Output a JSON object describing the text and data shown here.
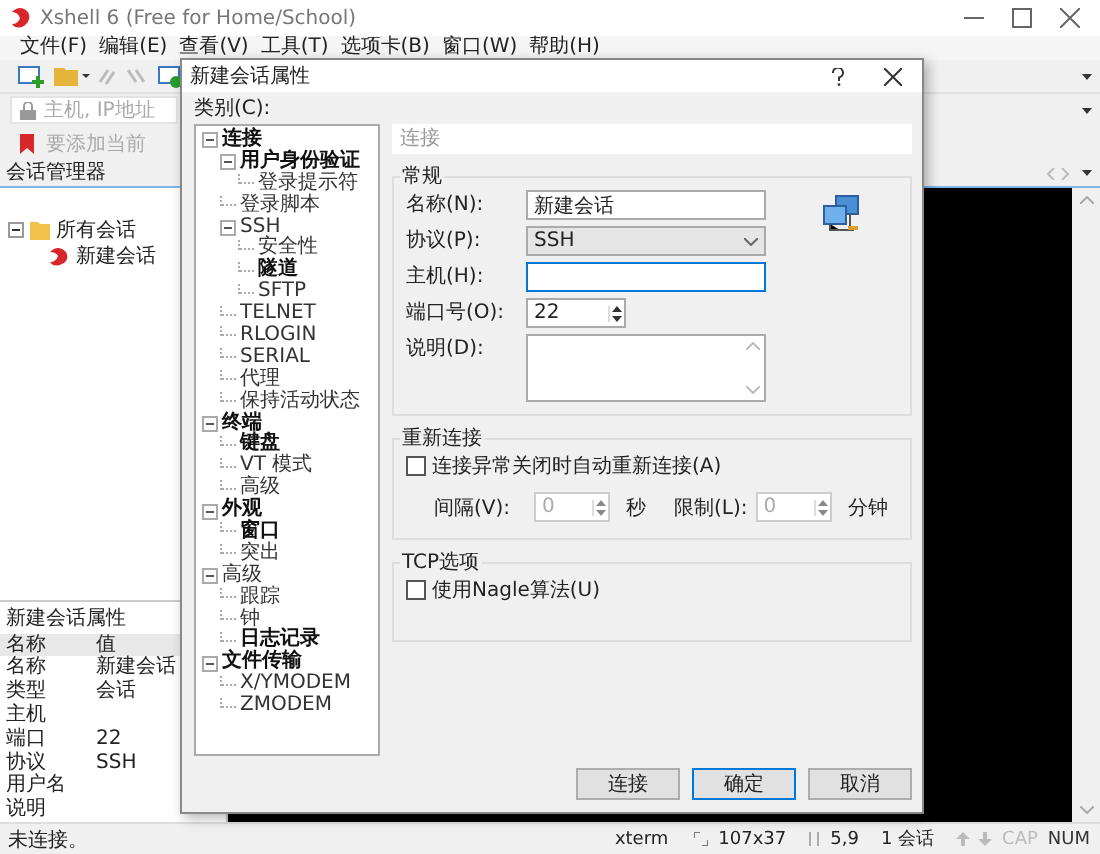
{
  "app": {
    "title": "Xshell 6 (Free for Home/School)",
    "menu": [
      "文件(F)",
      "编辑(E)",
      "查看(V)",
      "工具(T)",
      "选项卡(B)",
      "窗口(W)",
      "帮助(H)"
    ],
    "address_placeholder": "主机, IP地址",
    "hint": "要添加当前"
  },
  "session_manager": {
    "title": "会话管理器",
    "tree": [
      {
        "label": "所有会话",
        "kind": "folder",
        "children": [
          {
            "label": "新建会话",
            "kind": "session"
          }
        ]
      }
    ]
  },
  "properties": {
    "title": "新建会话属性",
    "columns": [
      "名称",
      "值"
    ],
    "rows": [
      {
        "name": "名称",
        "value": "新建会话"
      },
      {
        "name": "类型",
        "value": "会话"
      },
      {
        "name": "主机"
      },
      {
        "name": "端口",
        "value": "22"
      },
      {
        "name": "协议",
        "value": "SSH"
      },
      {
        "name": "用户名"
      },
      {
        "name": "说明"
      }
    ]
  },
  "dialog": {
    "title": "新建会话属性",
    "category_label": "类别(C):",
    "categories": [
      {
        "label": "连接",
        "bold": true,
        "children": [
          {
            "label": "用户身份验证",
            "bold": true,
            "children": [
              {
                "label": "登录提示符",
                "bold": false
              }
            ]
          },
          {
            "label": "登录脚本",
            "bold": false
          },
          {
            "label": "SSH",
            "bold": false,
            "children": [
              {
                "label": "安全性",
                "bold": false
              },
              {
                "label": "隧道",
                "bold": true
              },
              {
                "label": "SFTP",
                "bold": false
              }
            ]
          },
          {
            "label": "TELNET",
            "bold": false
          },
          {
            "label": "RLOGIN",
            "bold": false
          },
          {
            "label": "SERIAL",
            "bold": false
          },
          {
            "label": "代理",
            "bold": false
          },
          {
            "label": "保持活动状态",
            "bold": false
          }
        ]
      },
      {
        "label": "终端",
        "bold": true,
        "children": [
          {
            "label": "键盘",
            "bold": true
          },
          {
            "label": "VT 模式",
            "bold": false
          },
          {
            "label": "高级",
            "bold": false
          }
        ]
      },
      {
        "label": "外观",
        "bold": true,
        "children": [
          {
            "label": "窗口",
            "bold": true
          },
          {
            "label": "突出",
            "bold": false
          }
        ]
      },
      {
        "label": "高级",
        "bold": false,
        "children": [
          {
            "label": "跟踪",
            "bold": false
          },
          {
            "label": "钟",
            "bold": false
          },
          {
            "label": "日志记录",
            "bold": true
          }
        ]
      },
      {
        "label": "文件传输",
        "bold": true,
        "children": [
          {
            "label": "X/YMODEM",
            "bold": false
          },
          {
            "label": "ZMODEM",
            "bold": false
          }
        ]
      }
    ],
    "section_title": "连接",
    "general": {
      "title": "常规",
      "fields": [
        {
          "kind": "text",
          "label": "名称(N):",
          "value": "新建会话",
          "focused": false
        },
        {
          "kind": "select",
          "label": "协议(P):",
          "value": "SSH",
          "focused": false
        },
        {
          "kind": "text",
          "label": "主机(H):",
          "focused": true
        },
        {
          "kind": "spin",
          "label": "端口号(O):",
          "value": "22",
          "focused": false
        },
        {
          "kind": "textarea",
          "label": "说明(D):",
          "focused": false
        }
      ]
    },
    "reconnect": {
      "title": "重新连接",
      "checkbox": {
        "label": "连接异常关闭时自动重新连接(A)",
        "checked": false
      },
      "spinners": [
        {
          "label": "间隔(V):",
          "value": "0",
          "unit": "秒",
          "disabled": true
        },
        {
          "label": "限制(L):",
          "value": "0",
          "unit": "分钟",
          "disabled": true
        }
      ]
    },
    "tcp": {
      "title": "TCP选项",
      "checkbox": {
        "label": "使用Nagle算法(U)",
        "checked": false
      }
    },
    "buttons": [
      {
        "label": "连接",
        "default": false
      },
      {
        "label": "确定",
        "default": true
      },
      {
        "label": "取消",
        "default": false
      }
    ]
  },
  "status_bar": {
    "message": "未连接。",
    "items": [
      {
        "kind": "terminal",
        "text": "xterm"
      },
      {
        "kind": "size",
        "text": "107x37"
      },
      {
        "kind": "cursor",
        "text": "5,9"
      },
      {
        "kind": "sessions",
        "text": "1 会话"
      }
    ],
    "locks": [
      {
        "text": "CAP",
        "on": false
      },
      {
        "text": "NUM",
        "on": true
      }
    ]
  }
}
